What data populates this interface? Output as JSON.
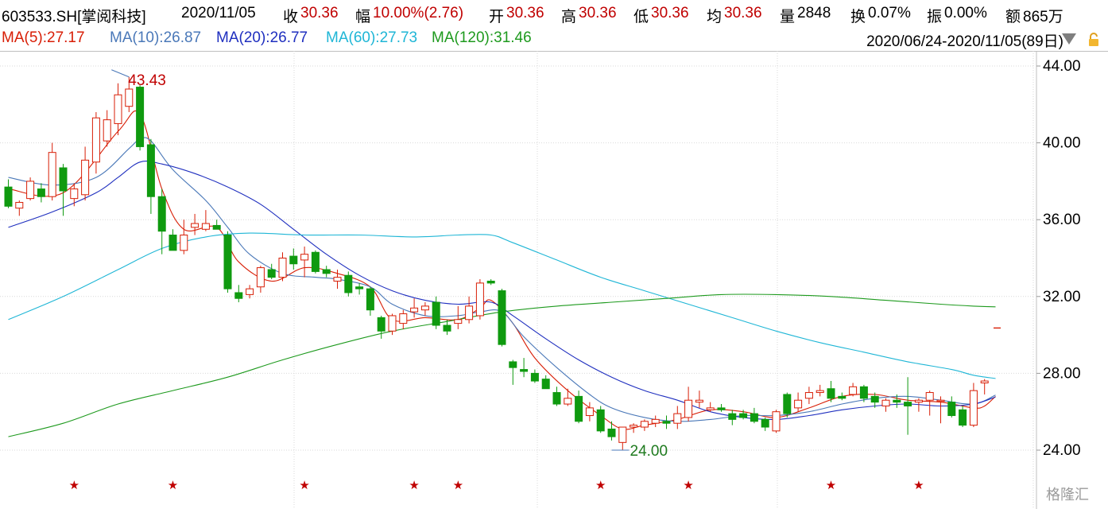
{
  "header": {
    "symbol": "603533.SH[掌阅科技]",
    "date": "2020/11/05",
    "close_label": "收",
    "close_value": "30.36",
    "change_label": "幅",
    "change_value": "10.00%(2.76)",
    "open_label": "开",
    "open_value": "30.36",
    "high_label": "高",
    "high_value": "30.36",
    "low_label": "低",
    "low_value": "30.36",
    "avg_label": "均",
    "avg_value": "30.36",
    "vol_label": "量",
    "vol_value": "2848",
    "turnover_label": "换",
    "turnover_value": "0.07%",
    "amp_label": "振",
    "amp_value": "0.00%",
    "amount_label": "额",
    "amount_value": "865万"
  },
  "ma_legend": [
    {
      "text": "MA(5):27.17",
      "color": "#d81e06"
    },
    {
      "text": "MA(10):26.87",
      "color": "#4a78b8"
    },
    {
      "text": "MA(20):26.77",
      "color": "#1f2fbf"
    },
    {
      "text": "MA(60):27.73",
      "color": "#1fb6d6"
    },
    {
      "text": "MA(120):31.46",
      "color": "#1e9a1e"
    }
  ],
  "date_range": "2020/06/24-2020/11/05(89日)",
  "watermark": "格隆汇",
  "chart_data": {
    "type": "candlestick",
    "ylim": [
      22.4,
      45.2
    ],
    "y_ticks": [
      "44.00",
      "40.00",
      "36.00",
      "32.00",
      "28.00",
      "24.00"
    ],
    "max_label": "43.43",
    "min_label": "24.00",
    "colors": {
      "up": "#d81e06",
      "down": "#0f9a0f",
      "grid": "#d9d9d9",
      "star": "#c00000"
    },
    "candles": [
      {
        "o": 37.7,
        "h": 38.1,
        "l": 36.6,
        "c": 36.7
      },
      {
        "o": 36.6,
        "h": 37.0,
        "l": 36.2,
        "c": 36.9
      },
      {
        "o": 37.1,
        "h": 38.2,
        "l": 37.0,
        "c": 38.0
      },
      {
        "o": 37.6,
        "h": 37.9,
        "l": 36.9,
        "c": 37.2
      },
      {
        "o": 37.2,
        "h": 40.0,
        "l": 37.0,
        "c": 39.5
      },
      {
        "o": 38.7,
        "h": 38.9,
        "l": 36.2,
        "c": 37.5
      },
      {
        "o": 37.1,
        "h": 37.9,
        "l": 36.7,
        "c": 37.6
      },
      {
        "o": 37.3,
        "h": 39.8,
        "l": 37.0,
        "c": 39.1
      },
      {
        "o": 39.0,
        "h": 41.6,
        "l": 38.4,
        "c": 41.3
      },
      {
        "o": 40.1,
        "h": 41.7,
        "l": 39.8,
        "c": 41.2
      },
      {
        "o": 41.0,
        "h": 43.1,
        "l": 40.4,
        "c": 42.5
      },
      {
        "o": 41.9,
        "h": 43.43,
        "l": 41.6,
        "c": 42.8
      },
      {
        "o": 42.9,
        "h": 43.0,
        "l": 39.6,
        "c": 39.8
      },
      {
        "o": 39.9,
        "h": 40.2,
        "l": 36.3,
        "c": 37.2
      },
      {
        "o": 37.2,
        "h": 37.6,
        "l": 34.2,
        "c": 35.4
      },
      {
        "o": 35.2,
        "h": 35.5,
        "l": 34.4,
        "c": 34.4
      },
      {
        "o": 34.4,
        "h": 36.0,
        "l": 34.2,
        "c": 35.2
      },
      {
        "o": 35.6,
        "h": 36.3,
        "l": 35.2,
        "c": 35.8
      },
      {
        "o": 35.5,
        "h": 36.5,
        "l": 35.4,
        "c": 35.8
      },
      {
        "o": 35.7,
        "h": 36.0,
        "l": 35.5,
        "c": 35.5
      },
      {
        "o": 35.2,
        "h": 35.4,
        "l": 32.2,
        "c": 32.4
      },
      {
        "o": 32.2,
        "h": 32.6,
        "l": 31.7,
        "c": 31.9
      },
      {
        "o": 32.1,
        "h": 32.6,
        "l": 31.9,
        "c": 32.4
      },
      {
        "o": 32.5,
        "h": 33.6,
        "l": 32.2,
        "c": 33.5
      },
      {
        "o": 33.4,
        "h": 33.7,
        "l": 32.9,
        "c": 33.0
      },
      {
        "o": 33.0,
        "h": 34.3,
        "l": 32.8,
        "c": 34.0
      },
      {
        "o": 34.1,
        "h": 34.5,
        "l": 33.4,
        "c": 33.7
      },
      {
        "o": 33.9,
        "h": 34.6,
        "l": 33.0,
        "c": 34.2
      },
      {
        "o": 34.3,
        "h": 34.4,
        "l": 33.2,
        "c": 33.3
      },
      {
        "o": 33.4,
        "h": 33.6,
        "l": 33.0,
        "c": 33.2
      },
      {
        "o": 32.8,
        "h": 33.4,
        "l": 32.4,
        "c": 33.0
      },
      {
        "o": 33.1,
        "h": 33.3,
        "l": 32.0,
        "c": 32.2
      },
      {
        "o": 32.5,
        "h": 32.7,
        "l": 32.1,
        "c": 32.4
      },
      {
        "o": 32.4,
        "h": 32.5,
        "l": 31.0,
        "c": 31.3
      },
      {
        "o": 30.9,
        "h": 31.0,
        "l": 29.8,
        "c": 30.2
      },
      {
        "o": 30.2,
        "h": 31.1,
        "l": 30.0,
        "c": 31.0
      },
      {
        "o": 30.6,
        "h": 31.3,
        "l": 30.3,
        "c": 31.1
      },
      {
        "o": 31.2,
        "h": 31.9,
        "l": 30.9,
        "c": 31.4
      },
      {
        "o": 31.3,
        "h": 31.7,
        "l": 31.0,
        "c": 31.5
      },
      {
        "o": 31.7,
        "h": 32.0,
        "l": 30.3,
        "c": 30.5
      },
      {
        "o": 30.5,
        "h": 30.8,
        "l": 30.0,
        "c": 30.2
      },
      {
        "o": 30.6,
        "h": 31.5,
        "l": 30.3,
        "c": 30.8
      },
      {
        "o": 30.8,
        "h": 32.0,
        "l": 30.6,
        "c": 31.5
      },
      {
        "o": 31.0,
        "h": 32.9,
        "l": 30.8,
        "c": 32.7
      },
      {
        "o": 32.8,
        "h": 32.9,
        "l": 32.6,
        "c": 32.7
      },
      {
        "o": 32.3,
        "h": 32.4,
        "l": 29.4,
        "c": 29.5
      },
      {
        "o": 28.6,
        "h": 28.7,
        "l": 27.4,
        "c": 28.3
      },
      {
        "o": 28.2,
        "h": 28.8,
        "l": 27.8,
        "c": 28.1
      },
      {
        "o": 28.0,
        "h": 28.2,
        "l": 27.5,
        "c": 27.6
      },
      {
        "o": 27.7,
        "h": 27.9,
        "l": 27.2,
        "c": 27.2
      },
      {
        "o": 27.0,
        "h": 27.3,
        "l": 26.3,
        "c": 26.4
      },
      {
        "o": 26.4,
        "h": 27.2,
        "l": 26.3,
        "c": 26.7
      },
      {
        "o": 26.8,
        "h": 27.1,
        "l": 25.4,
        "c": 25.5
      },
      {
        "o": 25.8,
        "h": 26.5,
        "l": 25.5,
        "c": 26.2
      },
      {
        "o": 26.1,
        "h": 26.3,
        "l": 24.9,
        "c": 25.0
      },
      {
        "o": 25.1,
        "h": 25.5,
        "l": 24.5,
        "c": 24.7
      },
      {
        "o": 24.4,
        "h": 25.2,
        "l": 24.0,
        "c": 25.2
      },
      {
        "o": 25.2,
        "h": 25.4,
        "l": 24.9,
        "c": 25.3
      },
      {
        "o": 25.2,
        "h": 25.6,
        "l": 25.0,
        "c": 25.5
      },
      {
        "o": 25.4,
        "h": 25.8,
        "l": 25.2,
        "c": 25.6
      },
      {
        "o": 25.5,
        "h": 25.8,
        "l": 25.1,
        "c": 25.4
      },
      {
        "o": 25.4,
        "h": 26.3,
        "l": 25.1,
        "c": 25.9
      },
      {
        "o": 25.7,
        "h": 27.3,
        "l": 25.5,
        "c": 26.6
      },
      {
        "o": 26.5,
        "h": 27.1,
        "l": 26.2,
        "c": 26.6
      },
      {
        "o": 26.1,
        "h": 26.5,
        "l": 26.0,
        "c": 26.2
      },
      {
        "o": 26.2,
        "h": 26.4,
        "l": 26.0,
        "c": 26.1
      },
      {
        "o": 25.9,
        "h": 26.1,
        "l": 25.3,
        "c": 25.6
      },
      {
        "o": 25.9,
        "h": 26.1,
        "l": 25.6,
        "c": 25.7
      },
      {
        "o": 25.9,
        "h": 26.2,
        "l": 25.4,
        "c": 25.5
      },
      {
        "o": 25.6,
        "h": 25.7,
        "l": 25.0,
        "c": 25.2
      },
      {
        "o": 25.0,
        "h": 26.1,
        "l": 24.9,
        "c": 26.0
      },
      {
        "o": 26.9,
        "h": 27.0,
        "l": 25.7,
        "c": 25.9
      },
      {
        "o": 26.2,
        "h": 27.0,
        "l": 26.0,
        "c": 26.6
      },
      {
        "o": 26.7,
        "h": 27.3,
        "l": 26.4,
        "c": 27.0
      },
      {
        "o": 27.0,
        "h": 27.4,
        "l": 26.8,
        "c": 27.1
      },
      {
        "o": 27.2,
        "h": 27.6,
        "l": 26.5,
        "c": 26.7
      },
      {
        "o": 26.8,
        "h": 27.0,
        "l": 26.6,
        "c": 26.7
      },
      {
        "o": 26.9,
        "h": 27.5,
        "l": 26.8,
        "c": 27.3
      },
      {
        "o": 27.3,
        "h": 27.4,
        "l": 26.5,
        "c": 26.7
      },
      {
        "o": 26.8,
        "h": 27.0,
        "l": 26.2,
        "c": 26.5
      },
      {
        "o": 26.3,
        "h": 26.7,
        "l": 26.0,
        "c": 26.6
      },
      {
        "o": 26.6,
        "h": 26.9,
        "l": 26.2,
        "c": 26.5
      },
      {
        "o": 26.5,
        "h": 27.8,
        "l": 24.8,
        "c": 26.3
      },
      {
        "o": 26.5,
        "h": 26.7,
        "l": 26.0,
        "c": 26.6
      },
      {
        "o": 26.6,
        "h": 27.1,
        "l": 25.8,
        "c": 27.0
      },
      {
        "o": 26.6,
        "h": 26.8,
        "l": 25.4,
        "c": 26.6
      },
      {
        "o": 26.5,
        "h": 26.8,
        "l": 25.7,
        "c": 25.8
      },
      {
        "o": 26.1,
        "h": 26.3,
        "l": 25.2,
        "c": 25.3
      },
      {
        "o": 25.3,
        "h": 27.5,
        "l": 25.2,
        "c": 27.1
      },
      {
        "o": 27.5,
        "h": 27.7,
        "l": 26.9,
        "c": 27.6
      }
    ],
    "limit_day": {
      "o": 30.36,
      "h": 30.36,
      "l": 30.36,
      "c": 30.36
    },
    "star_indices": [
      6,
      15,
      27,
      37,
      41,
      54,
      62,
      75,
      83
    ],
    "ma_anchors": {
      "MA5": [
        [
          0,
          37.6
        ],
        [
          5,
          37.4
        ],
        [
          10,
          40.6
        ],
        [
          12,
          41.5
        ],
        [
          14,
          37.6
        ],
        [
          16,
          35.5
        ],
        [
          19,
          35.6
        ],
        [
          21,
          33.8
        ],
        [
          24,
          32.8
        ],
        [
          27,
          33.5
        ],
        [
          30,
          33.2
        ],
        [
          33,
          32.5
        ],
        [
          35,
          30.8
        ],
        [
          38,
          30.9
        ],
        [
          41,
          30.8
        ],
        [
          43,
          31.4
        ],
        [
          44,
          31.8
        ],
        [
          46,
          30.6
        ],
        [
          48,
          28.8
        ],
        [
          51,
          27.1
        ],
        [
          54,
          25.8
        ],
        [
          56,
          25.1
        ],
        [
          58,
          25.3
        ],
        [
          61,
          25.6
        ],
        [
          64,
          26.1
        ],
        [
          67,
          26.0
        ],
        [
          70,
          25.7
        ],
        [
          73,
          26.2
        ],
        [
          76,
          26.8
        ],
        [
          79,
          26.9
        ],
        [
          82,
          26.6
        ],
        [
          85,
          26.5
        ],
        [
          88,
          26.2
        ],
        [
          89,
          26.3
        ],
        [
          90,
          26.8
        ]
      ],
      "MA10": [
        [
          0,
          38.2
        ],
        [
          4,
          37.8
        ],
        [
          8,
          38.2
        ],
        [
          11,
          39.7
        ],
        [
          12,
          40.2
        ],
        [
          13,
          40.1
        ],
        [
          15,
          38.6
        ],
        [
          18,
          37.0
        ],
        [
          20,
          35.6
        ],
        [
          22,
          34.2
        ],
        [
          25,
          33.2
        ],
        [
          28,
          33.0
        ],
        [
          30,
          32.9
        ],
        [
          33,
          32.5
        ],
        [
          35,
          31.6
        ],
        [
          38,
          31.0
        ],
        [
          41,
          31.0
        ],
        [
          43,
          31.2
        ],
        [
          45,
          31.2
        ],
        [
          47,
          29.9
        ],
        [
          50,
          28.3
        ],
        [
          53,
          26.9
        ],
        [
          55,
          26.2
        ],
        [
          58,
          25.7
        ],
        [
          61,
          25.5
        ],
        [
          64,
          25.6
        ],
        [
          67,
          25.8
        ],
        [
          70,
          25.8
        ],
        [
          73,
          26.0
        ],
        [
          76,
          26.4
        ],
        [
          79,
          26.7
        ],
        [
          82,
          26.8
        ],
        [
          85,
          26.6
        ],
        [
          88,
          26.4
        ],
        [
          90,
          26.87
        ]
      ],
      "MA20": [
        [
          0,
          35.6
        ],
        [
          4,
          36.4
        ],
        [
          8,
          37.4
        ],
        [
          10,
          38.2
        ],
        [
          12,
          39.0
        ],
        [
          14,
          38.9
        ],
        [
          17,
          38.4
        ],
        [
          20,
          37.7
        ],
        [
          23,
          36.8
        ],
        [
          26,
          35.5
        ],
        [
          29,
          34.2
        ],
        [
          32,
          33.1
        ],
        [
          35,
          32.3
        ],
        [
          38,
          31.8
        ],
        [
          41,
          31.6
        ],
        [
          44,
          31.7
        ],
        [
          46,
          31.0
        ],
        [
          49,
          29.8
        ],
        [
          52,
          28.7
        ],
        [
          55,
          27.8
        ],
        [
          58,
          27.1
        ],
        [
          61,
          26.6
        ],
        [
          64,
          26.0
        ],
        [
          67,
          25.7
        ],
        [
          70,
          25.6
        ],
        [
          73,
          25.8
        ],
        [
          76,
          26.1
        ],
        [
          79,
          26.3
        ],
        [
          82,
          26.4
        ],
        [
          85,
          26.3
        ],
        [
          88,
          26.4
        ],
        [
          90,
          26.77
        ]
      ],
      "MA60": [
        [
          0,
          30.8
        ],
        [
          5,
          32.0
        ],
        [
          10,
          33.4
        ],
        [
          14,
          34.5
        ],
        [
          18,
          35.1
        ],
        [
          22,
          35.3
        ],
        [
          27,
          35.2
        ],
        [
          32,
          35.2
        ],
        [
          37,
          35.1
        ],
        [
          41,
          35.2
        ],
        [
          44,
          35.2
        ],
        [
          46,
          34.8
        ],
        [
          50,
          33.9
        ],
        [
          54,
          33.0
        ],
        [
          58,
          32.3
        ],
        [
          62,
          31.6
        ],
        [
          66,
          30.9
        ],
        [
          70,
          30.2
        ],
        [
          74,
          29.6
        ],
        [
          78,
          29.1
        ],
        [
          82,
          28.6
        ],
        [
          86,
          28.2
        ],
        [
          88,
          27.9
        ],
        [
          90,
          27.73
        ]
      ],
      "MA120": [
        [
          0,
          24.7
        ],
        [
          5,
          25.4
        ],
        [
          10,
          26.4
        ],
        [
          15,
          27.1
        ],
        [
          20,
          27.8
        ],
        [
          25,
          28.7
        ],
        [
          30,
          29.5
        ],
        [
          35,
          30.2
        ],
        [
          40,
          30.7
        ],
        [
          45,
          31.2
        ],
        [
          50,
          31.5
        ],
        [
          55,
          31.7
        ],
        [
          60,
          31.9
        ],
        [
          65,
          32.1
        ],
        [
          70,
          32.1
        ],
        [
          75,
          32.0
        ],
        [
          80,
          31.8
        ],
        [
          85,
          31.6
        ],
        [
          88,
          31.5
        ],
        [
          90,
          31.46
        ]
      ]
    }
  }
}
